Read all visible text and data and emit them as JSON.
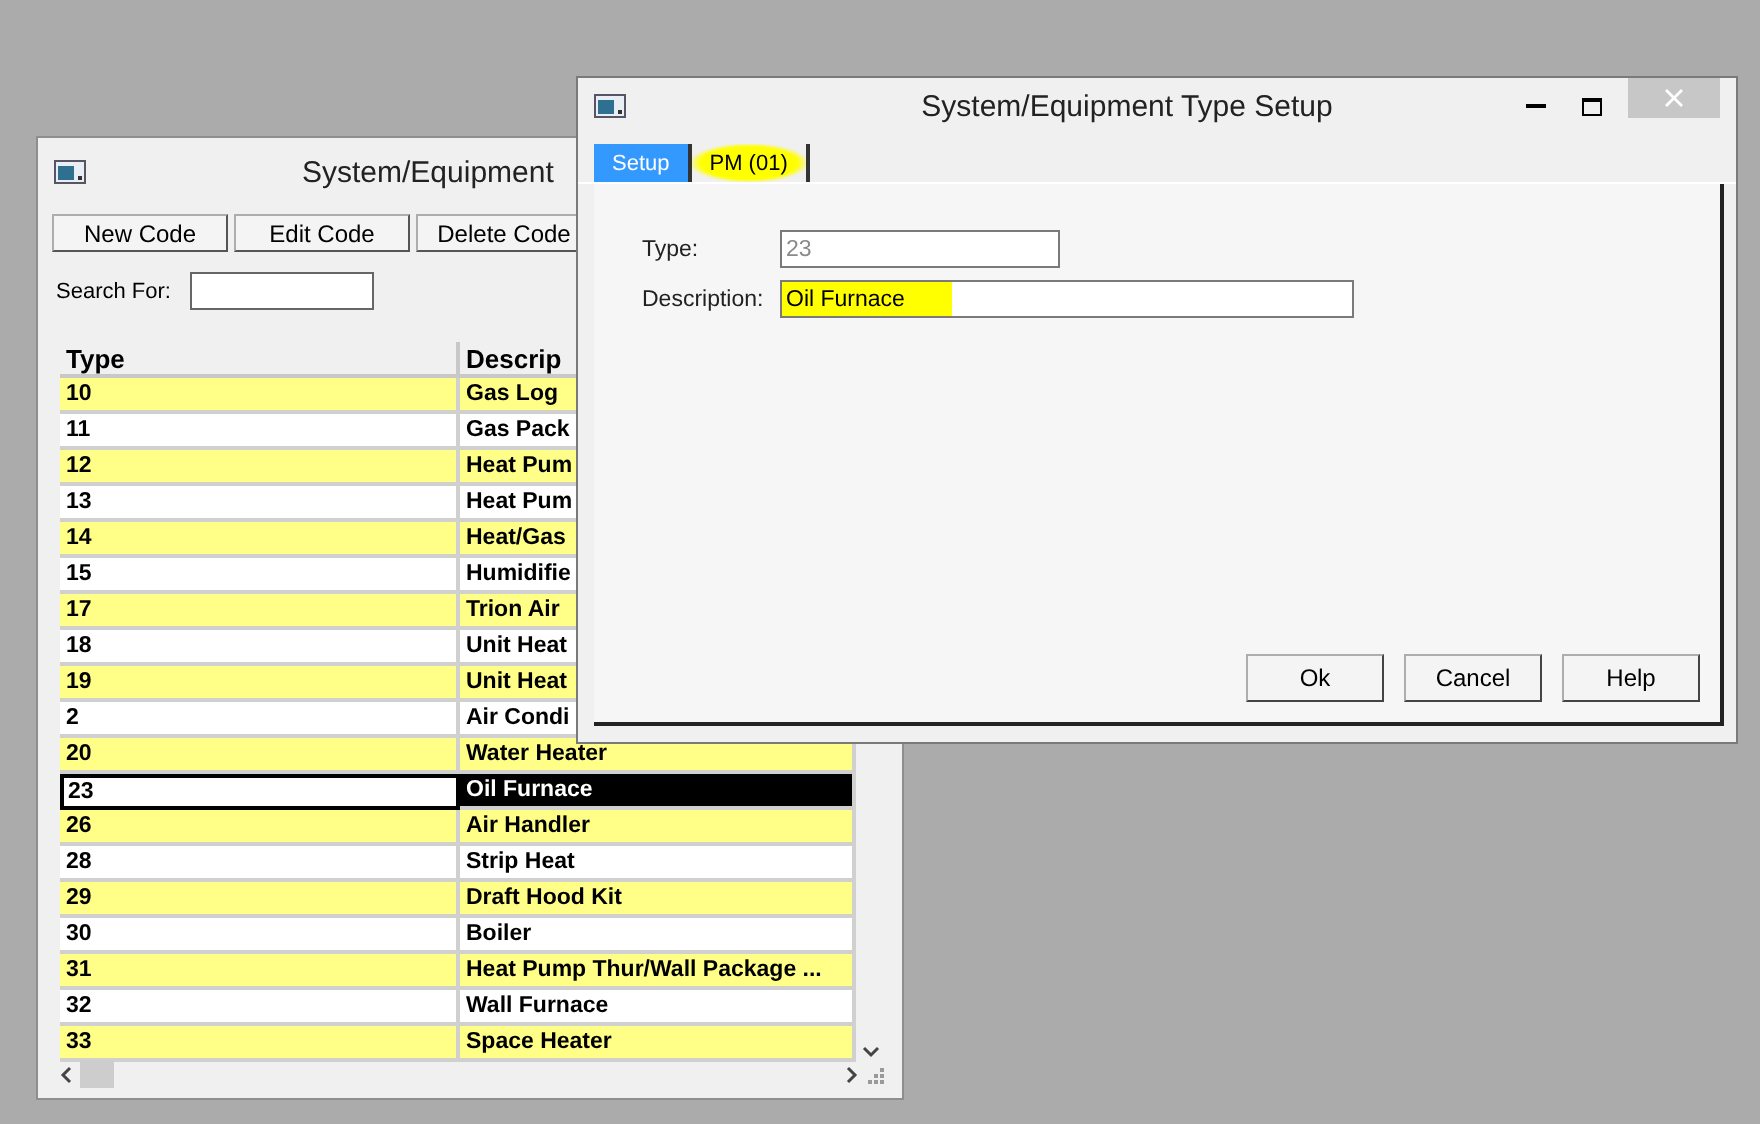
{
  "list_window": {
    "title": "System/Equipment",
    "toolbar": [
      "New Code",
      "Edit Code",
      "Delete Code"
    ],
    "search": {
      "label": "Search For:"
    },
    "table": {
      "columns": [
        "Type",
        "Descrip"
      ],
      "rows": [
        {
          "type": "10",
          "description": "Gas Log",
          "selected": false
        },
        {
          "type": "11",
          "description": "Gas Pack",
          "selected": false
        },
        {
          "type": "12",
          "description": "Heat Pum",
          "selected": false
        },
        {
          "type": "13",
          "description": "Heat Pum",
          "selected": false
        },
        {
          "type": "14",
          "description": "Heat/Gas",
          "selected": false
        },
        {
          "type": "15",
          "description": "Humidifie",
          "selected": false
        },
        {
          "type": "17",
          "description": "Trion Air",
          "selected": false
        },
        {
          "type": "18",
          "description": "Unit Heat",
          "selected": false
        },
        {
          "type": "19",
          "description": "Unit Heat",
          "selected": false
        },
        {
          "type": "2",
          "description": "Air Condi",
          "selected": false
        },
        {
          "type": "20",
          "description": "Water Heater",
          "selected": false
        },
        {
          "type": "23",
          "description": "Oil Furnace",
          "selected": true
        },
        {
          "type": "26",
          "description": "Air Handler",
          "selected": false
        },
        {
          "type": "28",
          "description": "Strip Heat",
          "selected": false
        },
        {
          "type": "29",
          "description": "Draft Hood Kit",
          "selected": false
        },
        {
          "type": "30",
          "description": "Boiler",
          "selected": false
        },
        {
          "type": "31",
          "description": "Heat Pump Thur/Wall Package ...",
          "selected": false
        },
        {
          "type": "32",
          "description": "Wall Furnace",
          "selected": false
        },
        {
          "type": "33",
          "description": "Space Heater",
          "selected": false
        }
      ]
    }
  },
  "dialog": {
    "title": "System/Equipment Type Setup",
    "tabs": [
      {
        "label": "Setup",
        "selected": true,
        "highlighted": false
      },
      {
        "label": "PM (01)",
        "selected": false,
        "highlighted": true
      }
    ],
    "fields": [
      {
        "label": "Type:",
        "value": "23",
        "disabled": true,
        "highlighted": false
      },
      {
        "label": "Description:",
        "value": "Oil Furnace",
        "disabled": false,
        "highlighted": true
      }
    ],
    "buttons": [
      "Ok",
      "Cancel",
      "Help"
    ]
  }
}
